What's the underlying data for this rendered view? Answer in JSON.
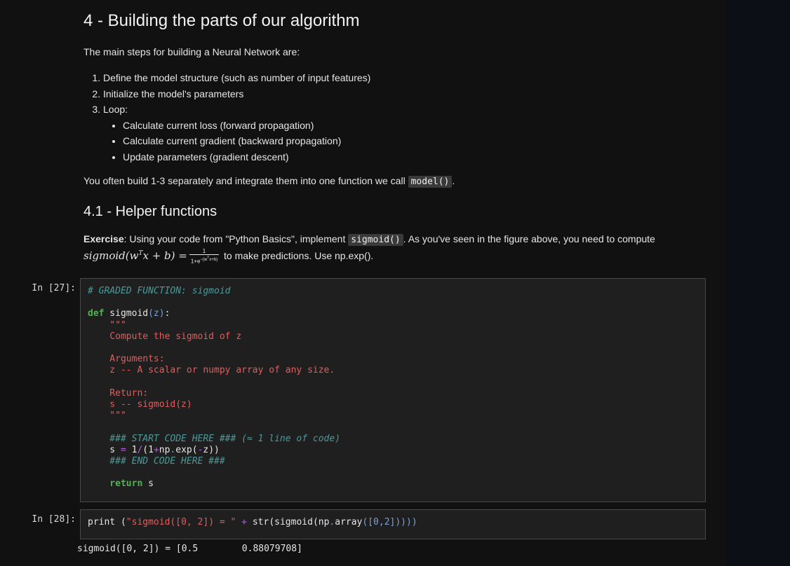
{
  "section": {
    "title": "4 - Building the parts of our algorithm",
    "intro": "The main steps for building a Neural Network are:",
    "steps": [
      "Define the model structure (such as number of input features)",
      "Initialize the model's parameters",
      "Loop:"
    ],
    "loop_substeps": [
      "Calculate current loss (forward propagation)",
      "Calculate current gradient (backward propagation)",
      "Update parameters (gradient descent)"
    ],
    "summary_prefix": "You often build 1-3 separately and integrate them into one function we call",
    "summary_code": "model()",
    "summary_suffix": "."
  },
  "subsection": {
    "title": "4.1 - Helper functions",
    "exercise_label": "Exercise",
    "exercise_text": ": Using your code from \"Python Basics\", implement",
    "exercise_code": "sigmoid()",
    "exercise_rest": ". As you've seen in the figure above, you need to compute",
    "formula_lhs": "sigmoid(w",
    "formula_sup": "T",
    "formula_mid": "x + b) =",
    "formula_num": "1",
    "formula_den": "1+e",
    "formula_den_sup": "−(w",
    "formula_den_sup2": "T",
    "formula_den_sup3": "x+b)",
    "formula_suffix": "to make predictions. Use np.exp()."
  },
  "cells": [
    {
      "prompt": "In [27]:",
      "code": {
        "c1": "# GRADED FUNCTION: sigmoid",
        "def_kw": "def",
        "fn": " sigmoid",
        "args": "(z)",
        "colon": ":",
        "doc_open": "    \"\"\"",
        "doc1": "    Compute the sigmoid of z",
        "doc2": "    Arguments:",
        "doc3": "    z -- A scalar or numpy array of any size.",
        "doc4": "    Return:",
        "doc5": "    s -- sigmoid(z)",
        "doc_close": "    \"\"\"",
        "c2": "    ### START CODE HERE ### (≈ 1 line of code)",
        "assign_s": "    s ",
        "assign_eq": "=",
        "assign_one": " 1",
        "assign_div": "/",
        "assign_open": "(",
        "assign_one2": "1",
        "assign_plus": "+",
        "assign_np": "np",
        "assign_dot": ".",
        "assign_exp": "exp",
        "assign_arg": "(",
        "assign_neg": "-",
        "assign_z": "z",
        "assign_close": "))",
        "c3": "    ### END CODE HERE ###",
        "ret_kw": "    return",
        "ret_val": " s"
      }
    },
    {
      "prompt": "In [28]:",
      "code": {
        "print": "print ",
        "p_open": "(",
        "str_lit": "\"sigmoid([0, 2]) = \"",
        "plus": " + ",
        "rest1": "str",
        "rest2": "(",
        "rest3": "sigmoid",
        "rest4": "(",
        "rest5": "np",
        "rest6": ".",
        "rest7": "array",
        "rest8": "([",
        "rest9": "0,2",
        "rest10": "]))))"
      },
      "output": "sigmoid([0, 2]) = [0.5        0.88079708]"
    }
  ]
}
